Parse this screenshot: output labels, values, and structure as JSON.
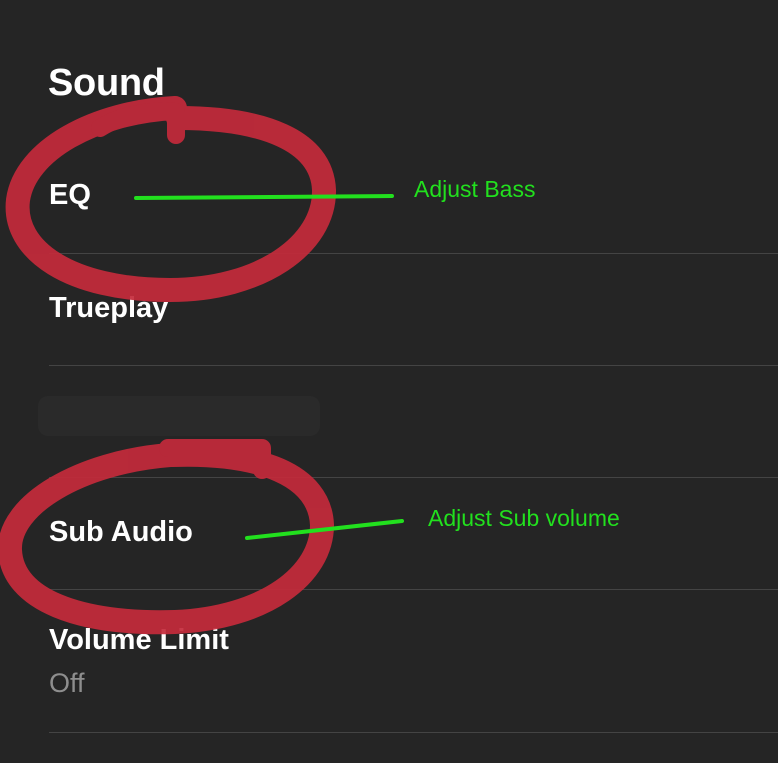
{
  "header": {
    "title": "Sound"
  },
  "settings": {
    "items": [
      {
        "label": "EQ"
      },
      {
        "label": "Trueplay"
      },
      {
        "label": ""
      },
      {
        "label": "Sub Audio"
      },
      {
        "label": "Volume Limit",
        "value": "Off"
      }
    ]
  },
  "annotations": {
    "eq_note": "Adjust Bass",
    "sub_note": "Adjust Sub volume",
    "circle_color": "#c42a3b",
    "line_color": "#22e01e"
  }
}
